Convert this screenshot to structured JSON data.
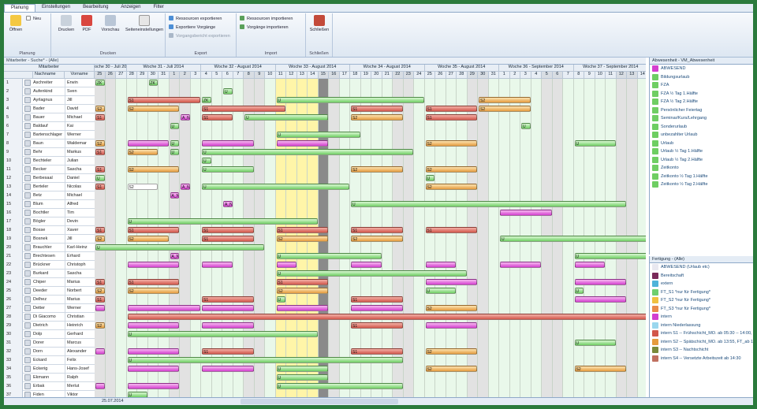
{
  "tabs": [
    "Planung",
    "Einstellungen",
    "Bearbeitung",
    "Anzeigen",
    "Filter"
  ],
  "ribbon": {
    "planung": {
      "label": "Planung",
      "btn1": "Neu",
      "btn2": "Öffnen"
    },
    "drucken": {
      "label": "Drucken",
      "buttons": [
        "Drucken",
        "PDF",
        "Vorschau",
        "Seiteneinstellungen"
      ]
    },
    "export": {
      "label": "Export",
      "rows": [
        "Ressourcen exportieren",
        "Exportiere Vorgänge",
        "Vorgangsbericht exportieren"
      ]
    },
    "import": {
      "label": "Import",
      "rows": [
        "Ressourcen importieren",
        "Vorgänge importieren"
      ]
    },
    "schliessen": {
      "label": "Schließen",
      "btn": "Schließen"
    }
  },
  "filterbar": "Mitarbeiter - Suche* - (Alle)",
  "grid": {
    "header_mitarbeiter": "Mitarbeiter",
    "col_nachname": "Nachname",
    "col_vorname": "Vorname",
    "weeks": [
      "oche 30 - Juli 20",
      "Woche 31 - Juli 2014",
      "Woche 32 - August 2014",
      "Woche 33 - August 2014",
      "Woche 34 - August 2014",
      "Woche 35 - August 2014",
      "Woche 36 - September 2014",
      "Woche 37 - September 2014",
      "Woche"
    ],
    "days": [
      "25",
      "26",
      "27",
      "28",
      "29",
      "30",
      "31",
      "1",
      "2",
      "3",
      "4",
      "5",
      "6",
      "7",
      "8",
      "9",
      "10",
      "11",
      "12",
      "13",
      "14",
      "15",
      "16",
      "17",
      "18",
      "19",
      "20",
      "21",
      "22",
      "23",
      "24",
      "25",
      "26",
      "27",
      "28",
      "29",
      "30",
      "31",
      "1",
      "2",
      "3",
      "4",
      "5",
      "6",
      "7",
      "8",
      "9",
      "10",
      "11",
      "12",
      "13",
      "14",
      "15"
    ],
    "rows": [
      {
        "n": "Aschreiter",
        "v": "Erwin"
      },
      {
        "n": "Aufenkind",
        "v": "Sven"
      },
      {
        "n": "Ayrlagnus",
        "v": "Jill"
      },
      {
        "n": "Bader",
        "v": "David"
      },
      {
        "n": "Bauer",
        "v": "Michael"
      },
      {
        "n": "Baldauf",
        "v": "Kai"
      },
      {
        "n": "Bartenschlager",
        "v": "Werner"
      },
      {
        "n": "Baun",
        "v": "Waldemar"
      },
      {
        "n": "Behr",
        "v": "Markus"
      },
      {
        "n": "Bechteler",
        "v": "Julian"
      },
      {
        "n": "Becker",
        "v": "Sascha"
      },
      {
        "n": "Berbesaal",
        "v": "Daniel"
      },
      {
        "n": "Berteler",
        "v": "Nicolas"
      },
      {
        "n": "Betz",
        "v": "Michael"
      },
      {
        "n": "Blum",
        "v": "Alfred"
      },
      {
        "n": "Bochtler",
        "v": "Tim"
      },
      {
        "n": "Bögler",
        "v": "Devin"
      },
      {
        "n": "Bosse",
        "v": "Xaver"
      },
      {
        "n": "Bosnek",
        "v": "Jill"
      },
      {
        "n": "Brauchler",
        "v": "Karl-Heinz"
      },
      {
        "n": "Brechtesen",
        "v": "Erhard"
      },
      {
        "n": "Brückner",
        "v": "Christoph"
      },
      {
        "n": "Burkard",
        "v": "Sascha"
      },
      {
        "n": "Chiper",
        "v": "Marius"
      },
      {
        "n": "Deeder",
        "v": "Norbert"
      },
      {
        "n": "Delhez",
        "v": "Marius"
      },
      {
        "n": "Detter",
        "v": "Werner"
      },
      {
        "n": "Di Giacomo",
        "v": "Christian"
      },
      {
        "n": "Dietrich",
        "v": "Heinrich"
      },
      {
        "n": "Dolp",
        "v": "Gerhard"
      },
      {
        "n": "Dorer",
        "v": "Marcus"
      },
      {
        "n": "Dorn",
        "v": "Alexander"
      },
      {
        "n": "Eckard",
        "v": "Felix"
      },
      {
        "n": "Eckerig",
        "v": "Hans-Josef"
      },
      {
        "n": "Ekmann",
        "v": "Ralph"
      },
      {
        "n": "Erbak",
        "v": "Merlut"
      },
      {
        "n": "Fiden",
        "v": "Viktor"
      }
    ]
  },
  "panel_abw": {
    "title": "Abwesenheit - VM_Abwesenheit",
    "items": [
      "ABWESEND",
      "Bildungsurlaub",
      "FZA",
      "FZA ½ Tag 1.Hälfte",
      "FZA ½ Tag 2.Hälfte",
      "Persönlicher Feiertag",
      "Seminar/Kurs/Lehrgang",
      "Sonderurlaub",
      "unbezahlter Urlaub",
      "Urlaub",
      "Urlaub ½ Tag 1.Hälfte",
      "Urlaub ½ Tag 2.Hälfte",
      "Zeitkonto",
      "Zeitkonto ½ Tag 1.Hälfte",
      "Zeitkonto ½ Tag 2.Hälfte"
    ]
  },
  "panel_fert": {
    "title": "Fertigung - (Alle)",
    "items": [
      "ABWESEND (Urlaub etc)",
      "Bereitschaft",
      "extern",
      "FT_S1 *nur für Fertigung*",
      "FT_S2 *nur für Fertigung*",
      "FT_S3 *nur für Fertigung*",
      "intern",
      "intern Niederlassung",
      "intern S1 -- Frühschicht_MO. ab 05:30 -- 14:00, FT ab",
      "intern S2 -- Spätschicht_MO. ab 13:55, FT_ab 13:20",
      "intern S3 -- Nachtschicht",
      "intern S4 -- Versetzte Arbeitszeit ab 14:30"
    ],
    "colors": [
      "#e8e8f0",
      "#7a2a5a",
      "#4fb3d9",
      "#6fcf6f",
      "#f0c040",
      "#e98a4a",
      "#d23fd0",
      "#9ad7ee",
      "#d2574b",
      "#e59b3e",
      "#7a8a3a",
      "#c07060"
    ]
  },
  "abw_colors": [
    "#d43fcf",
    "#6fce63"
  ],
  "status": {
    "date": "25.07.2014"
  },
  "colors": {
    "accent": "#2a7a3c",
    "weekend": "#e2e2e2",
    "today": "#fff5a8",
    "weekfill": "#e9f8ea"
  }
}
